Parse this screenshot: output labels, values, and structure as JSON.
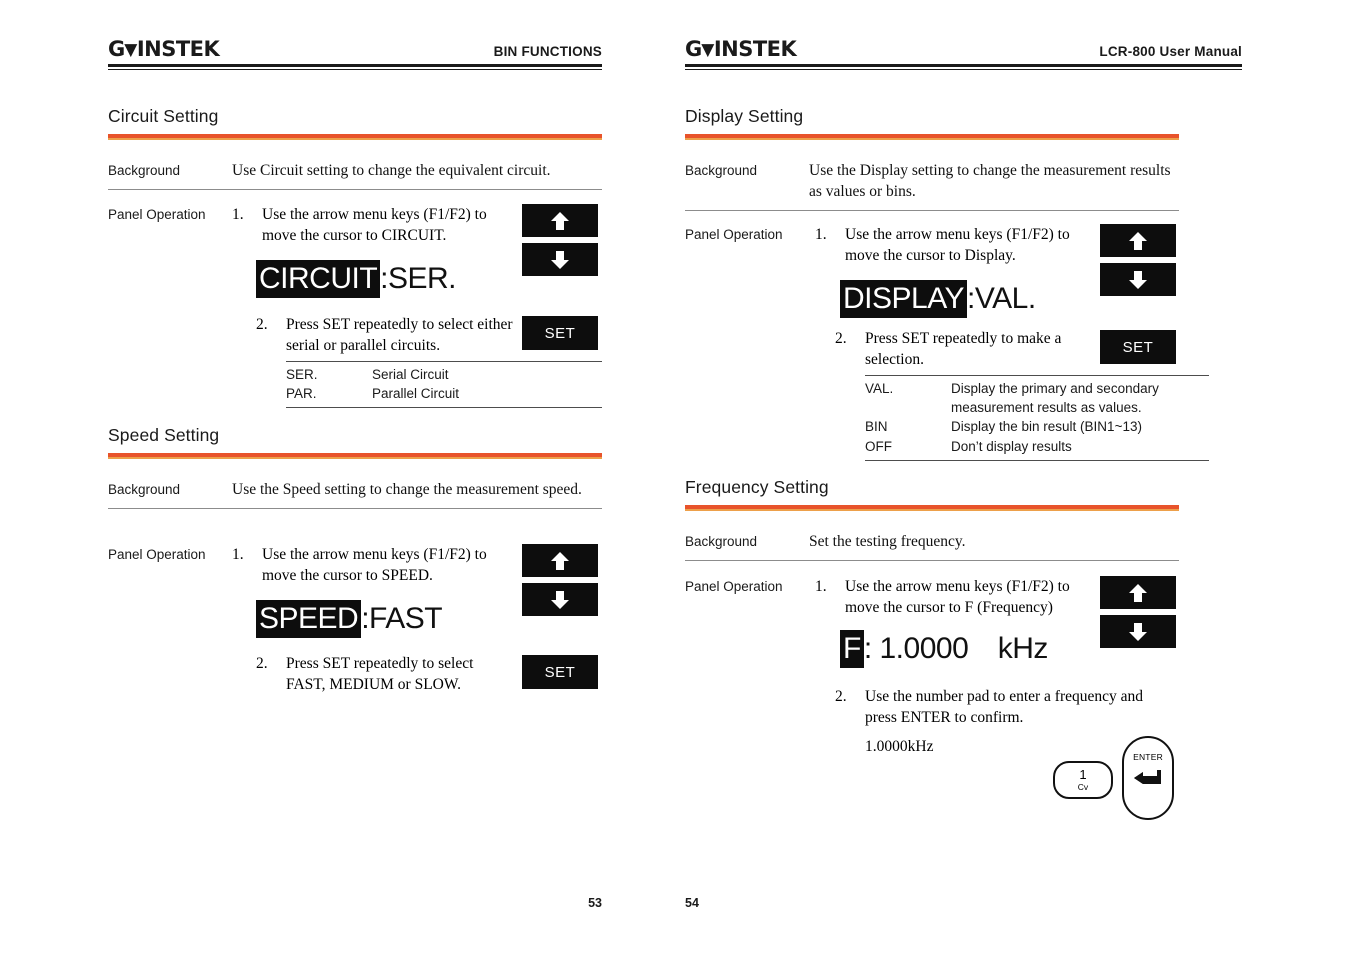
{
  "left_page": {
    "header": {
      "logo": "GWINSTEK",
      "title": "BIN FUNCTIONS"
    },
    "page_number": "53",
    "sections": [
      {
        "title": "Circuit Setting",
        "background_label": "Background",
        "background_text": "Use Circuit setting to change the equivalent circuit.",
        "panel_label": "Panel Operation",
        "step1_num": "1.",
        "step1_text": "Use the arrow menu keys (F1/F2) to move the cursor to CIRCUIT.",
        "lcd_inverted": "CIRCUIT",
        "lcd_plain": ":SER.",
        "step2_num": "2.",
        "step2_text": "Press SET repeatedly to select either serial or parallel circuits.",
        "set_key": "SET",
        "options": [
          {
            "key": "SER.",
            "value": "Serial Circuit"
          },
          {
            "key": "PAR.",
            "value": "Parallel Circuit"
          }
        ]
      },
      {
        "title": "Speed Setting",
        "background_label": "Background",
        "background_text": "Use the Speed setting to change the measurement speed.",
        "panel_label": "Panel Operation",
        "step1_num": "1.",
        "step1_text": "Use the arrow menu keys (F1/F2) to move the cursor to SPEED.",
        "lcd_inverted": "SPEED",
        "lcd_plain": ":FAST",
        "step2_num": "2.",
        "step2_text": "Press SET repeatedly to select FAST, MEDIUM or SLOW.",
        "set_key": "SET"
      }
    ]
  },
  "right_page": {
    "header": {
      "logo": "GWINSTEK",
      "title": "LCR-800 User Manual"
    },
    "page_number": "54",
    "sections": [
      {
        "title": "Display Setting",
        "background_label": "Background",
        "background_text": "Use the Display setting to change the measurement results as values or bins.",
        "panel_label": "Panel Operation",
        "step1_num": "1.",
        "step1_text": "Use the arrow menu keys (F1/F2) to move the cursor to Display.",
        "lcd_inverted": "DISPLAY",
        "lcd_plain": ":VAL.",
        "step2_num": "2.",
        "step2_text": "Press SET repeatedly to make a selection.",
        "set_key": "SET",
        "options": [
          {
            "key": "VAL.",
            "value": "Display the primary and secondary measurement results as values."
          },
          {
            "key": "BIN",
            "value": "Display the bin result (BIN1~13)"
          },
          {
            "key": "OFF",
            "value": "Don’t display results"
          }
        ]
      },
      {
        "title": "Frequency Setting",
        "background_label": "Background",
        "background_text": "Set the testing frequency.",
        "panel_label": "Panel Operation",
        "step1_num": "1.",
        "step1_text": "Use the arrow menu keys (F1/F2) to move the cursor to F (Frequency)",
        "lcd_inverted": "F",
        "lcd_plain": ": 1.0000 kHz",
        "step2_num": "2.",
        "step2_text": "Use the number pad to enter a frequency and press ENTER to confirm.",
        "value_text": "1.0000kHz",
        "keypad": {
          "num_key_main": "1",
          "num_key_sub": "Cv",
          "enter_key_label": "ENTER"
        }
      }
    ]
  },
  "colors": {
    "rule_top": "#e8532b",
    "rule_bottom": "#eda04a",
    "ink": "#1a1a1a",
    "key_black": "#0d0d0d"
  }
}
